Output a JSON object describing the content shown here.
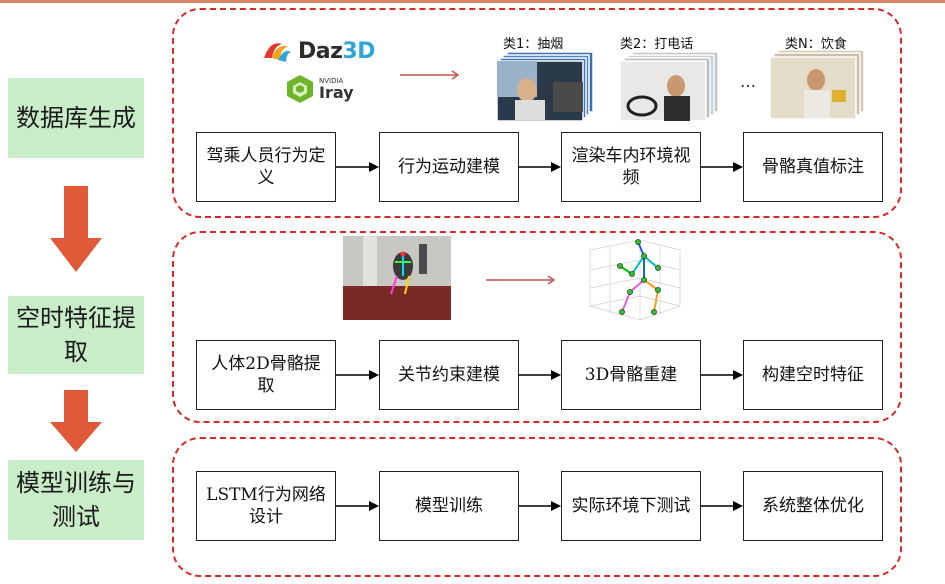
{
  "stages": [
    {
      "label": "数据库生成"
    },
    {
      "label": "空时特征提取"
    },
    {
      "label": "模型训练与测试"
    }
  ],
  "logos": {
    "daz_name": "Daz",
    "daz_suffix": "3D",
    "nvidia": "NVIDIA",
    "iray": "Iray"
  },
  "classes": [
    {
      "caption": "类1：抽烟"
    },
    {
      "caption": "类2：打电话"
    },
    {
      "caption": "类N：饮食"
    }
  ],
  "ellipsis": "…",
  "rows": [
    {
      "steps": [
        "驾乘人员行为定义",
        "行为运动建模",
        "渲染车内环境视频",
        "骨骼真值标注"
      ]
    },
    {
      "steps": [
        "人体2D骨骼提取",
        "关节约束建模",
        "3D骨骼重建",
        "构建空时特征"
      ]
    },
    {
      "steps": [
        "LSTM行为网络设计",
        "模型训练",
        "实际环境下测试",
        "系统整体优化"
      ]
    }
  ],
  "colors": {
    "stage_bg": "#c9ecc9",
    "big_arrow": "#e05a3a",
    "dashed_border": "#d62a2a",
    "thin_arrow": "#c0504d"
  }
}
